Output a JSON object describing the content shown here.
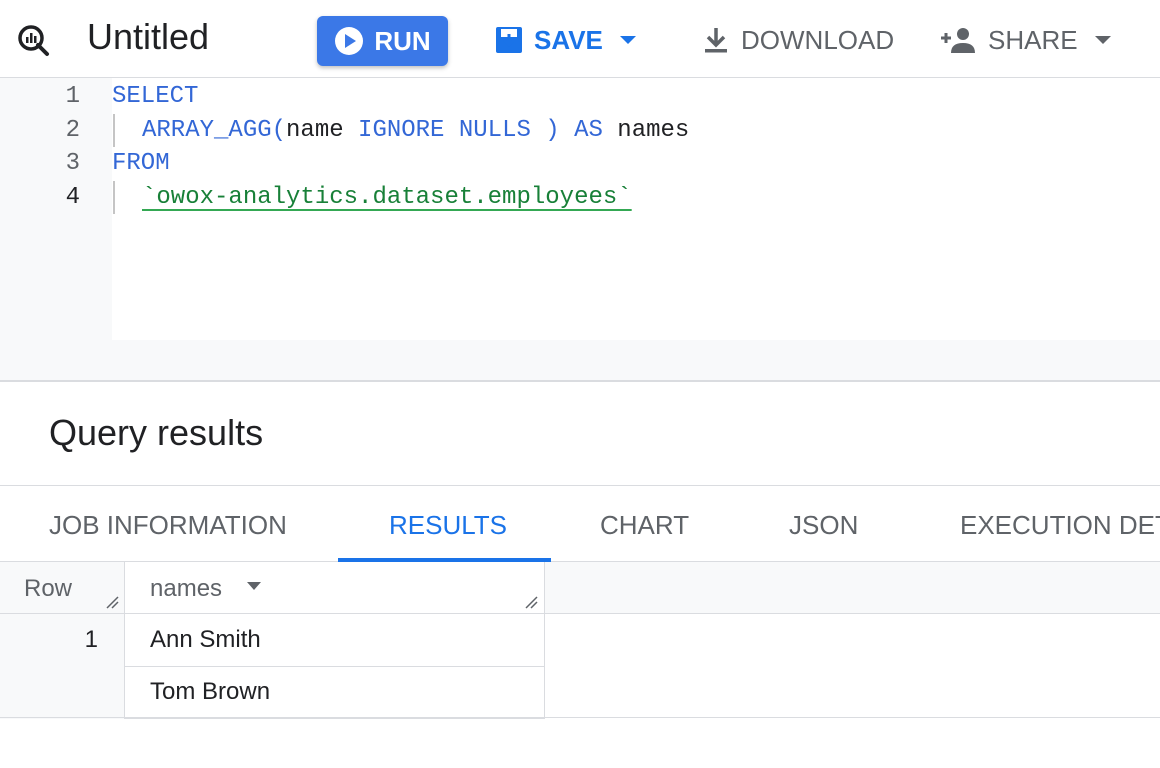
{
  "header": {
    "title": "Untitled",
    "run_label": "RUN",
    "save_label": "SAVE",
    "download_label": "DOWNLOAD",
    "share_label": "SHARE"
  },
  "editor": {
    "lines": [
      {
        "num": "1",
        "kw1": "SELECT"
      },
      {
        "num": "2",
        "fn": "ARRAY_AGG(",
        "arg": "name",
        "mod": " IGNORE NULLS ) AS ",
        "alias": "names"
      },
      {
        "num": "3",
        "kw1": "FROM"
      },
      {
        "num": "4",
        "table": "`owox-analytics.dataset.employees`"
      }
    ]
  },
  "results": {
    "title": "Query results",
    "tabs": [
      "JOB INFORMATION",
      "RESULTS",
      "CHART",
      "JSON",
      "EXECUTION DET"
    ],
    "active_tab": "RESULTS",
    "columns": [
      "Row",
      "names"
    ],
    "rows": [
      {
        "row": "1",
        "names": [
          "Ann Smith",
          "Tom Brown"
        ]
      }
    ]
  },
  "colors": {
    "accent": "#1a73e8",
    "run_button": "#3b78e7",
    "keyword": "#3367d6",
    "string": "#188038"
  }
}
